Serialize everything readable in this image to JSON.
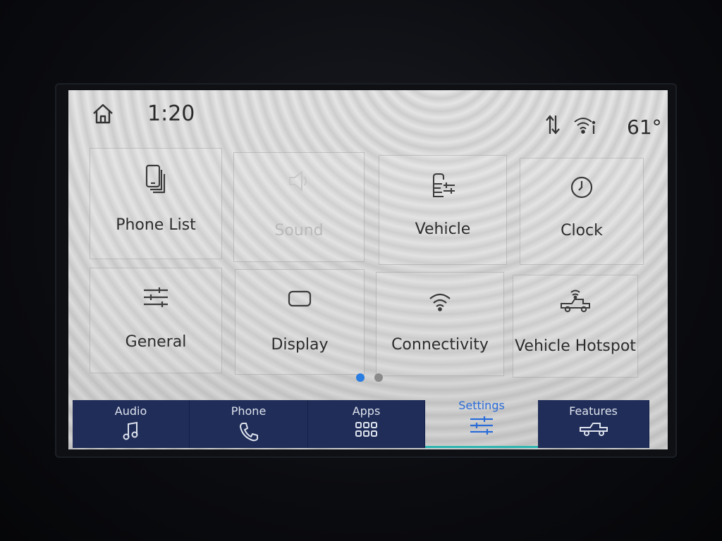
{
  "status_bar": {
    "time": "1:20",
    "temperature": "61°"
  },
  "tiles": [
    {
      "label": "Phone List",
      "icon": "phone-list-icon",
      "enabled": true
    },
    {
      "label": "Sound",
      "icon": "speaker-icon",
      "enabled": false
    },
    {
      "label": "Vehicle",
      "icon": "vehicle-settings-icon",
      "enabled": true
    },
    {
      "label": "Clock",
      "icon": "clock-icon",
      "enabled": true
    },
    {
      "label": "General",
      "icon": "sliders-icon",
      "enabled": true
    },
    {
      "label": "Display",
      "icon": "display-icon",
      "enabled": true
    },
    {
      "label": "Connectivity",
      "icon": "wifi-icon",
      "enabled": true
    },
    {
      "label": "Vehicle Hotspot",
      "icon": "truck-wifi-icon",
      "enabled": true
    }
  ],
  "pagination": {
    "current": 1,
    "total": 2
  },
  "nav": {
    "tabs": [
      {
        "label": "Audio",
        "icon": "music-note-icon",
        "active": false
      },
      {
        "label": "Phone",
        "icon": "phone-handset-icon",
        "active": false
      },
      {
        "label": "Apps",
        "icon": "apps-grid-icon",
        "active": false
      },
      {
        "label": "Settings",
        "icon": "settings-sliders-icon",
        "active": true
      },
      {
        "label": "Features",
        "icon": "truck-icon",
        "active": false
      }
    ]
  },
  "colors": {
    "nav_background": "#1f2d58",
    "active_tab_text": "#2a6cd8",
    "active_underline": "#2bb5b0",
    "dot_active": "#2a7de1",
    "dot_inactive": "#8a8a8a"
  }
}
